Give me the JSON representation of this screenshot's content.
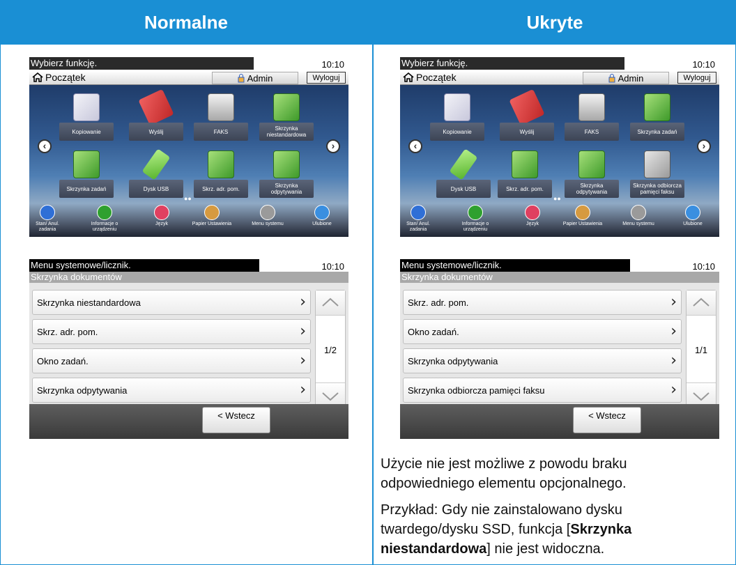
{
  "headers": {
    "left": "Normalne",
    "right": "Ukryte"
  },
  "home": {
    "title": "Wybierz funkcję.",
    "time": "10:10",
    "home_label": "Początek",
    "admin_label": "Admin",
    "logout_label": "Wyloguj",
    "bottom_items": [
      {
        "label": "Stan/ Anul. zadania",
        "color": "#2f6fd6"
      },
      {
        "label": "Informacje o urządzeniu",
        "color": "#2fa02f"
      },
      {
        "label": "Język",
        "color": "#e04060"
      },
      {
        "label": "Papier Ustawienia",
        "color": "#d69a40"
      },
      {
        "label": "Menu systemu",
        "color": "#9a9a9a"
      },
      {
        "label": "Ulubione",
        "color": "#3a8fe0"
      }
    ],
    "left_tiles": [
      "Kopiowanie",
      "Wyślij",
      "FAKS",
      "Skrzynka niestandardowa",
      "Skrzynka zadań",
      "Dysk USB",
      "Skrz. adr. pom.",
      "Skrzynka odpytywania"
    ],
    "right_tiles": [
      "Kopiowanie",
      "Wyślij",
      "FAKS",
      "Skrzynka zadań",
      "Dysk USB",
      "Skrz. adr. pom.",
      "Skrzynka odpytywania",
      "Skrzynka odbiorcza pamięci faksu"
    ]
  },
  "menu": {
    "title": "Menu systemowe/licznik.",
    "time": "10:10",
    "subtitle": "Skrzynka dokumentów",
    "back_label": "< Wstecz",
    "left_rows": [
      "Skrzynka niestandardowa",
      "Skrz. adr. pom.",
      "Okno zadań.",
      "Skrzynka odpytywania"
    ],
    "left_page": "1/2",
    "right_rows": [
      "Skrz. adr. pom.",
      "Okno zadań.",
      "Skrzynka odpytywania",
      "Skrzynka odbiorcza pamięci faksu"
    ],
    "right_page": "1/1"
  },
  "note": {
    "p1": "Użycie nie jest możliwe z powodu braku odpowiedniego elementu opcjonalnego.",
    "p2_pre": "Przykład: Gdy nie zainstalowano dysku twardego/dysku SSD, funkcja [",
    "p2_bold": "Skrzynka niestandardowa",
    "p2_post": "] nie jest widoczna."
  }
}
